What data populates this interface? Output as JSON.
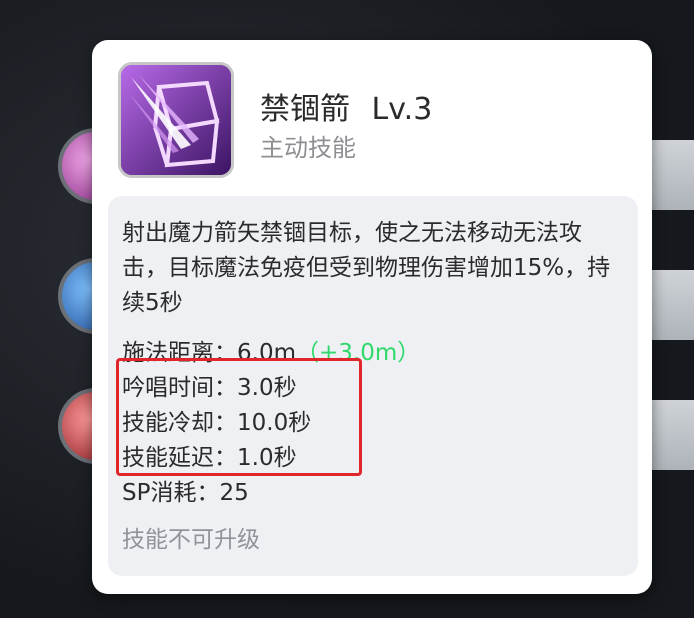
{
  "skill": {
    "name": "禁锢箭",
    "level": "Lv.3",
    "type": "主动技能",
    "description": "射出魔力箭矢禁锢目标，使之无法移动无法攻击，目标魔法免疫但受到物理伤害增加15%，持续5秒",
    "stats": [
      {
        "label": "施法距离：",
        "value": "6.0m",
        "bonus": "（+3.0m）"
      },
      {
        "label": "吟唱时间：",
        "value": "3.0秒"
      },
      {
        "label": "技能冷却：",
        "value": "10.0秒"
      },
      {
        "label": "技能延迟：",
        "value": "1.0秒"
      },
      {
        "label": "SP消耗：",
        "value": "25"
      }
    ],
    "footer": "技能不可升级"
  },
  "icons": {
    "skill_icon": "arrow-cube-icon",
    "side_icons": [
      "pink-skill-icon",
      "blue-skill-icon",
      "red-skill-icon"
    ]
  },
  "colors": {
    "bonus": "#2fd96a",
    "highlight": "#e0262b",
    "icon_purple": "#9b4fd0"
  }
}
